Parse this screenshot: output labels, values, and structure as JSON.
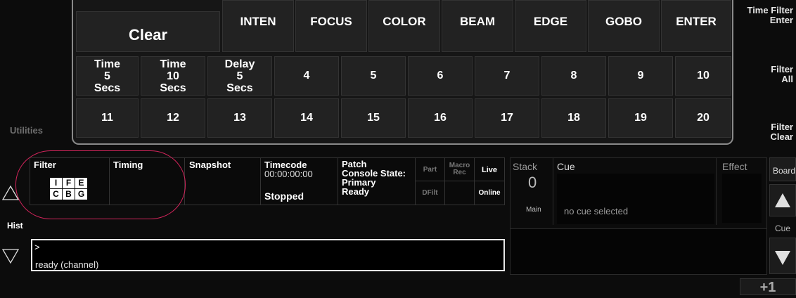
{
  "keypad": {
    "clear_label": "Clear",
    "top_row": [
      "INTEN",
      "FOCUS",
      "COLOR",
      "BEAM",
      "EDGE",
      "GOBO",
      "ENTER"
    ],
    "time_keys": [
      {
        "line1": "Time",
        "line2": "5",
        "line3": "Secs"
      },
      {
        "line1": "Time",
        "line2": "10",
        "line3": "Secs"
      },
      {
        "line1": "Delay",
        "line2": "5",
        "line3": "Secs"
      }
    ],
    "mid_numbers": [
      "4",
      "5",
      "6",
      "7",
      "8",
      "9",
      "10"
    ],
    "bottom_numbers": [
      "11",
      "12",
      "13",
      "14",
      "15",
      "16",
      "17",
      "18",
      "19",
      "20"
    ]
  },
  "right_filters": {
    "time_filter_line1": "Time Filter",
    "time_filter_line2": "Enter",
    "filter_all_line1": "Filter",
    "filter_all_line2": "All",
    "filter_clear_line1": "Filter",
    "filter_clear_line2": "Clear"
  },
  "utilities_label": "Utilities",
  "status": {
    "filter_label": "Filter",
    "filter_boxes": [
      "I",
      "F",
      "E",
      "C",
      "B",
      "G"
    ],
    "timing_label": "Timing",
    "snapshot_label": "Snapshot",
    "timecode_label": "Timecode",
    "timecode_value": "00:00:00:00",
    "timecode_state": "Stopped",
    "patch_line1": "Patch",
    "patch_line2": "Console State:",
    "patch_line3": "Primary",
    "patch_line4": "Ready",
    "part_label": "Part",
    "macro_line1": "Macro",
    "macro_line2": "Rec",
    "live_label": "Live",
    "dfilt_label": "DFilt",
    "online_label": "Online"
  },
  "hist_label": "Hist",
  "command_line": {
    "prompt": ">",
    "status": "ready (channel)"
  },
  "cue_panel": {
    "stack_label": "Stack",
    "stack_value": "0",
    "stack_sub": "Main",
    "cue_label": "Cue",
    "cue_status": "no cue selected",
    "effect_label": "Effect"
  },
  "right_buttons": {
    "board_label": "Board",
    "cue_label": "Cue",
    "plus_one": "+1"
  },
  "colors": {
    "accent_outline": "#d0245a",
    "key_face": "#222222",
    "background": "#0c0c0c"
  }
}
